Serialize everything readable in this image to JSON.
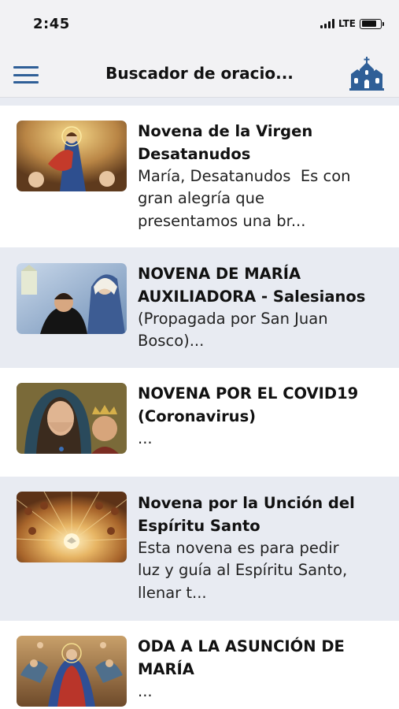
{
  "status_bar": {
    "time": "2:45",
    "network": "LTE"
  },
  "header": {
    "title": "Buscador de oracio..."
  },
  "items": [
    {
      "title_line1": "Novena de la Virgen",
      "title_line2": "Desatanudos",
      "desc_line1": "María, Desatanudos  Es con",
      "desc_line2": "gran alegría que",
      "desc_line3": "presentamos una br..."
    },
    {
      "title_line1": "NOVENA DE MARÍA",
      "title_line2": "AUXILIADORA - Salesianos",
      "desc_line1": "(Propagada por San Juan",
      "desc_line2": "Bosco)..."
    },
    {
      "title_line1": "NOVENA POR EL COVID19",
      "title_line2": "(Coronavirus)",
      "desc_line1": "..."
    },
    {
      "title_line1": "Novena por la Unción del",
      "title_line2": "Espíritu Santo",
      "desc_line1": "Esta novena es para pedir",
      "desc_line2": "luz y guía al Espíritu Santo,",
      "desc_line3": "llenar t..."
    },
    {
      "title_line1": "ODA A LA ASUNCIÓN DE",
      "title_line2": "MARÍA",
      "desc_line1": "..."
    }
  ],
  "colors": {
    "accent": "#2f5f97",
    "row_tint": "#e8ebf2",
    "bar_bg": "#f2f2f4"
  },
  "icons": {
    "menu": "hamburger-menu-icon",
    "church": "church-icon"
  }
}
